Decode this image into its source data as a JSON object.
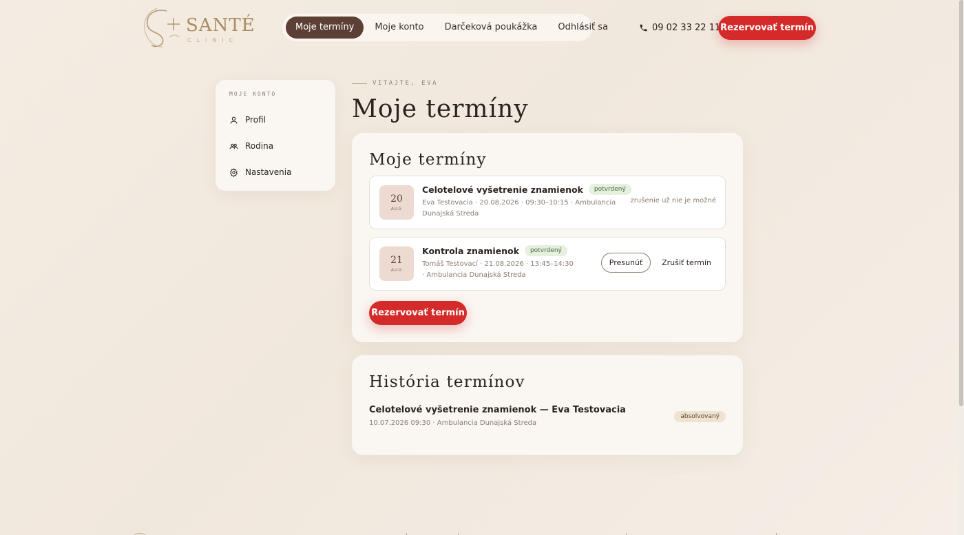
{
  "brand": {
    "name": "SANTÉ",
    "sub": "CLINIC"
  },
  "nav": {
    "items": [
      {
        "label": "Moje termíny",
        "active": true
      },
      {
        "label": "Moje konto",
        "active": false
      },
      {
        "label": "Darčeková poukážka",
        "active": false
      },
      {
        "label": "Odhlásiť sa",
        "active": false
      }
    ]
  },
  "header": {
    "phone": "09 02 33 22 11",
    "cta": "Rezervovať termín"
  },
  "sidebar": {
    "title": "MOJE KONTO",
    "items": [
      {
        "label": "Profil",
        "icon": "user-icon"
      },
      {
        "label": "Rodina",
        "icon": "family-icon"
      },
      {
        "label": "Nastavenia",
        "icon": "gear-icon"
      }
    ]
  },
  "page": {
    "eyebrow": "VITAJTE, EVA",
    "title": "Moje termíny"
  },
  "appointments": {
    "title": "Moje termíny",
    "items": [
      {
        "day": "20",
        "month": "AUG",
        "name": "Celotelové vyšetrenie znamienok",
        "status": "potvrdený",
        "meta": "Eva Testovacia · 20.08.2026 · 09:30–10:15 · Ambulancia Dunajská Streda",
        "note": "zrušenie už nie je možné"
      },
      {
        "day": "21",
        "month": "AUG",
        "name": "Kontrola znamienok",
        "status": "potvrdený",
        "meta": "Tomáš Testovací · 21.08.2026 · 13:45–14:30 · Ambulancia Dunajská Streda",
        "move_label": "Presunúť",
        "cancel_label": "Zrušiť termín"
      }
    ],
    "cta": "Rezervovať termín"
  },
  "history": {
    "title": "História termínov",
    "items": [
      {
        "name": "Celotelové vyšetrenie znamienok — Eva Testovacia",
        "meta": "10.07.2026 09:30 · Ambulancia Dunajská Streda",
        "status": "absolvovaný"
      }
    ]
  },
  "colors": {
    "accent": "#d42a2a",
    "nav_active": "#5d4035",
    "brand_gold": "#a88b63",
    "background": "#f4ece2"
  }
}
